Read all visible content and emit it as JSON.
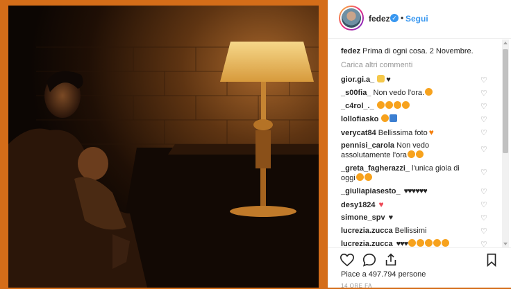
{
  "header": {
    "username": "fedez",
    "separator": "•",
    "follow_label": "Segui"
  },
  "caption": {
    "username": "fedez",
    "text": "Prima di ogni cosa. 2 Novembre."
  },
  "load_more_label": "Carica altri commenti",
  "comments": [
    {
      "user": "gior.gi.a_",
      "text": "",
      "emoji": "praying-hands black-heart"
    },
    {
      "user": "_s00fia_",
      "text": "Non vedo l'ora.",
      "emoji": "heart-eyes"
    },
    {
      "user": "_c4rol_._",
      "text": "",
      "emoji": "heart-eyes x4"
    },
    {
      "user": "lollofiasko",
      "text": "",
      "emoji": "heart-eyes anchor"
    },
    {
      "user": "verycat84",
      "text": "Bellissima foto",
      "emoji": "orange-heart"
    },
    {
      "user": "pennisi_carola",
      "text": "Non vedo",
      "text2": "assolutamente l'ora",
      "emoji": "heart-eyes x2"
    },
    {
      "user": "_greta_fagherazzi_",
      "text": "l'unica gioia di",
      "text2": "oggi",
      "emoji": "heart-eyes x2"
    },
    {
      "user": "_giuliapiasesto_",
      "text": "",
      "emoji": "black-heart x6"
    },
    {
      "user": "desy1824",
      "text": "",
      "emoji": "red-heart"
    },
    {
      "user": "simone_spv",
      "text": "",
      "emoji": "black-heart"
    },
    {
      "user": "lucrezia.zucca",
      "text": "Bellissimi",
      "emoji": ""
    },
    {
      "user": "lucrezia.zucca",
      "text": "",
      "emoji": "black-heart x3 lion x5"
    }
  ],
  "likes_text": "Piace a 497.794 persone",
  "timestamp": "14 ORE FA",
  "colors": {
    "background_orange": "#d46d19",
    "link_blue": "#3897f0",
    "text": "#262626",
    "muted": "#999999"
  }
}
